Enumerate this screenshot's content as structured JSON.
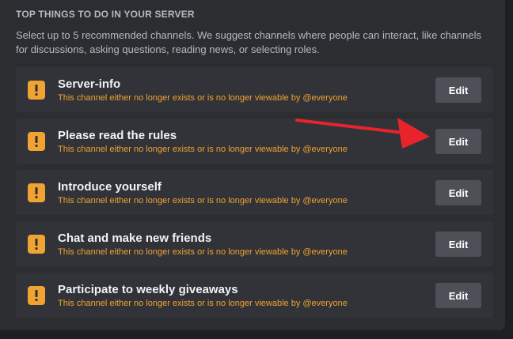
{
  "section": {
    "heading": "TOP THINGS TO DO IN YOUR SERVER",
    "description": "Select up to 5 recommended channels. We suggest channels where people can interact, like channels for discussions, asking questions, reading news, or selecting roles."
  },
  "channels": [
    {
      "title": "Server-info",
      "warning": "This channel either no longer exists or is no longer viewable by @everyone",
      "button_label": "Edit"
    },
    {
      "title": "Please read the rules",
      "warning": "This channel either no longer exists or is no longer viewable by @everyone",
      "button_label": "Edit"
    },
    {
      "title": "Introduce yourself",
      "warning": "This channel either no longer exists or is no longer viewable by @everyone",
      "button_label": "Edit"
    },
    {
      "title": "Chat and make new friends",
      "warning": "This channel either no longer exists or is no longer viewable by @everyone",
      "button_label": "Edit"
    },
    {
      "title": "Participate to weekly giveaways",
      "warning": "This channel either no longer exists or is no longer viewable by @everyone",
      "button_label": "Edit"
    }
  ],
  "icons": {
    "warning": "warning-icon",
    "annotation": "red-arrow-annotation"
  },
  "colors": {
    "background": "#1e1f22",
    "panel": "#2b2d31",
    "card": "#313338",
    "warning": "#f0a232",
    "button": "#4e5058",
    "arrow": "#e8232c"
  }
}
